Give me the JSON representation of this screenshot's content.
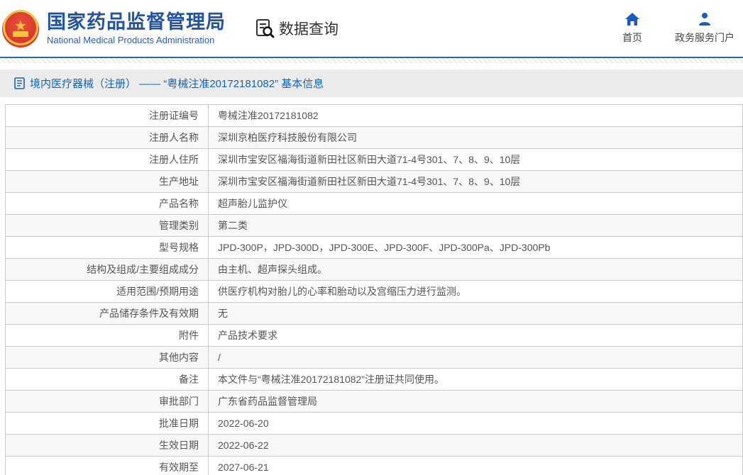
{
  "header": {
    "title": "国家药品监督管理局",
    "subtitle": "National Medical Products Administration",
    "query_label": "数据查询",
    "links": [
      {
        "label": "首页",
        "icon": "home-icon"
      },
      {
        "label": "政务服务门户",
        "icon": "user-icon"
      }
    ]
  },
  "breadcrumb": {
    "text": "境内医疗器械（注册） —— “粤械注准20172181082” 基本信息"
  },
  "table": {
    "rows": [
      {
        "label": "注册证编号",
        "value": "粤械注准20172181082"
      },
      {
        "label": "注册人名称",
        "value": "深圳京柏医疗科技股份有限公司"
      },
      {
        "label": "注册人住所",
        "value": "深圳市宝安区福海街道新田社区新田大道71-4号301、7、8、9、10层"
      },
      {
        "label": "生产地址",
        "value": "深圳市宝安区福海街道新田社区新田大道71-4号301、7、8、9、10层"
      },
      {
        "label": "产品名称",
        "value": "超声胎儿监护仪"
      },
      {
        "label": "管理类别",
        "value": "第二类"
      },
      {
        "label": "型号规格",
        "value": "JPD-300P，JPD-300D，JPD-300E、JPD-300F、JPD-300Pa、JPD-300Pb"
      },
      {
        "label": "结构及组成/主要组成成分",
        "value": "由主机、超声探头组成。"
      },
      {
        "label": "适用范围/预期用途",
        "value": "供医疗机构对胎儿的心率和胎动以及宫缩压力进行监测。"
      },
      {
        "label": "产品储存条件及有效期",
        "value": "无"
      },
      {
        "label": "附件",
        "value": "产品技术要求"
      },
      {
        "label": "其他内容",
        "value": "/"
      },
      {
        "label": "备注",
        "value": "本文件与“粤械注准20172181082”注册证共同使用。"
      },
      {
        "label": "审批部门",
        "value": "广东省药品监督管理局"
      },
      {
        "label": "批准日期",
        "value": "2022-06-20"
      },
      {
        "label": "生效日期",
        "value": "2022-06-22"
      },
      {
        "label": "有效期至",
        "value": "2027-06-21"
      }
    ]
  },
  "colors": {
    "brand_blue": "#2453a0",
    "crumb_blue": "#1563ad",
    "rule_blue": "#256c95",
    "icon_blue": "#1b5bbf",
    "emblem_red": "#d93a2b",
    "emblem_gold": "#f5c242",
    "row_alt_bg": "#f7f7f7",
    "border_gray": "#cccccc",
    "text_gray": "#555555"
  }
}
